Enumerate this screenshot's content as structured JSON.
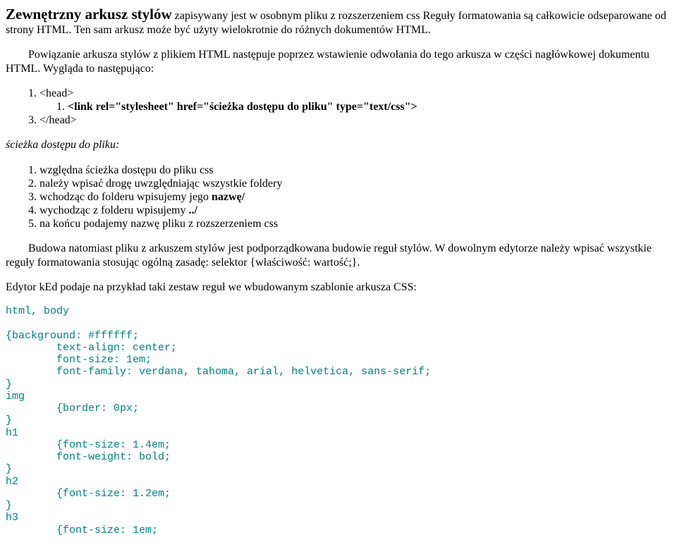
{
  "p1_lead": "Zewnętrzny arkusz stylów",
  "p1_rest": " zapisywany jest w osobnym pliku z rozszerzeniem css Reguły formatowania są całkowicie odseparowane od strony HTML. Ten sam arkusz może być użyty wielokrotnie do różnych dokumentów HTML.",
  "p2": "Powiązanie arkusza stylów z plikiem HTML następuje poprzez wstawienie odwołania do tego arkusza w części nagłówkowej dokumentu HTML. Wygląda to następująco:",
  "code1": {
    "i1": "<head>",
    "i2": "<link rel=\"stylesheet\" href=\"ścieżka dostępu do pliku\" type=\"text/css\">",
    "i3": "</head>"
  },
  "p3": "ścieżka dostępu do pliku:",
  "list2": {
    "i1": "względna ścieżka dostępu do pliku css",
    "i2": "należy wpisać drogę uwzględniając wszystkie foldery",
    "i3a": "wchodząc do folderu wpisujemy jego ",
    "i3b": "nazwę/",
    "i4a": "wychodząc z folderu wpisujemy ",
    "i4b": "../",
    "i5": "na końcu podajemy nazwę pliku z rozszerzeniem css"
  },
  "p4": "Budowa natomiast pliku z arkuszem stylów jest podporządkowana budowie reguł stylów. W dowolnym edytorze należy wpisać wszystkie reguły formatowania stosując ogólną zasadę: selektor {właściwość: wartość;}.",
  "p5": "Edytor kEd podaje na przykład taki zestaw reguł we wbudowanym szablonie arkusza CSS:",
  "codeblock": "html, body\n\n{background: #ffffff;\n        text-align: center;\n        font-size: 1em;\n        font-family: verdana, tahoma, arial, helvetica, sans-serif;\n}\nimg\n        {border: 0px;\n}\nh1\n        {font-size: 1.4em;\n        font-weight: bold;\n}\nh2\n        {font-size: 1.2em;\n}\nh3\n        {font-size: 1em;"
}
